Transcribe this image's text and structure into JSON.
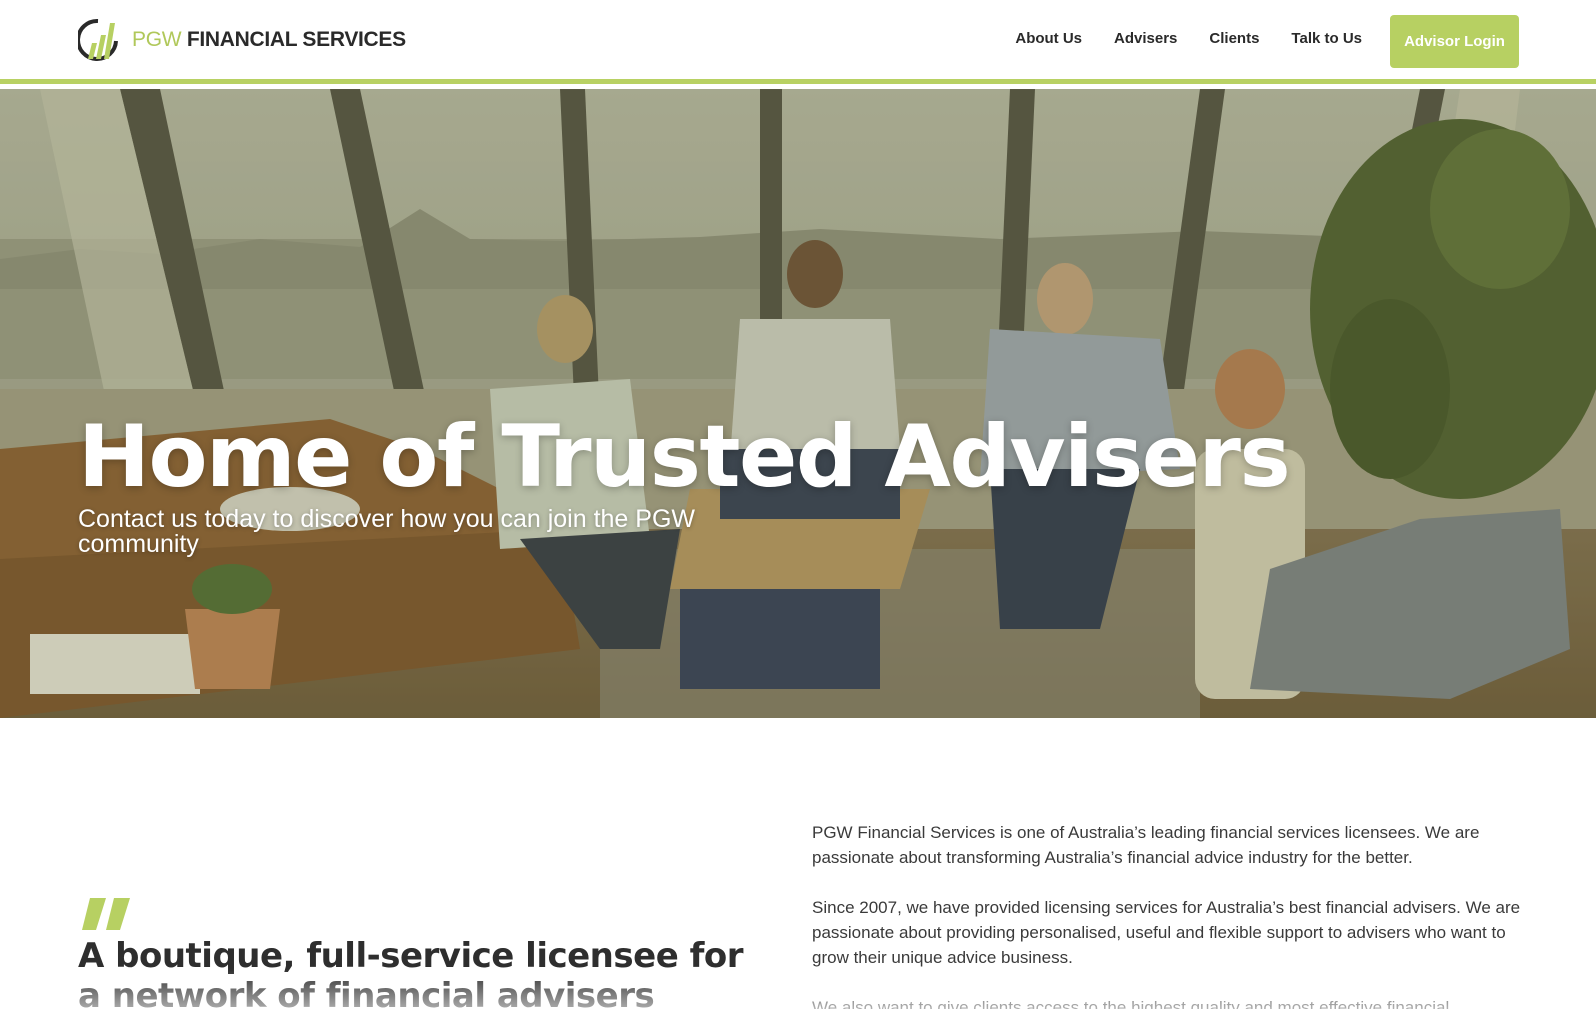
{
  "brand": {
    "name_accent": "PGW",
    "name_rest": "FINANCIAL SERVICES",
    "logo_icon": "pgw-bars-logo-icon",
    "accent_color": "#b7d062"
  },
  "nav": {
    "items": [
      {
        "label": "About Us"
      },
      {
        "label": "Advisers"
      },
      {
        "label": "Clients"
      },
      {
        "label": "Talk to Us"
      }
    ],
    "login_label": "Advisor Login"
  },
  "hero": {
    "title": "Home of Trusted Advisers",
    "subtitle": "Contact us today to discover how you can join the PGW community"
  },
  "intro": {
    "quote_icon": "quote-mark-icon",
    "tagline": "A boutique, full-service licensee for a network of financial advisers across",
    "paragraphs": [
      "PGW Financial Services is one of Australia’s leading financial services licensees. We are passionate about transforming Australia’s financial advice industry for the better.",
      "Since 2007, we have provided licensing services for Australia’s best financial advisers. We are passionate about providing personalised, useful and flexible support to advisers who want to grow their unique advice business.",
      "We also want to give clients access to the highest quality and most effective financial"
    ]
  }
}
